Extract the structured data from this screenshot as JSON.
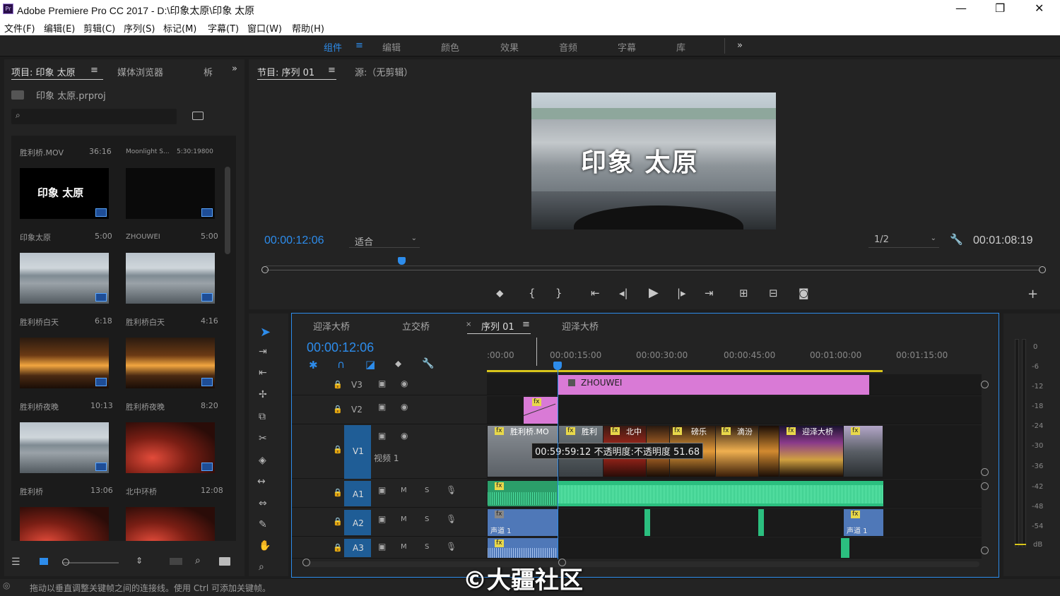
{
  "window": {
    "title": "Adobe Premiere Pro CC 2017 - D:\\印象太原\\印象 太原",
    "app_icon": "Pr",
    "controls": [
      "—",
      "❐",
      "✕"
    ]
  },
  "menu": [
    "文件(F)",
    "编辑(E)",
    "剪辑(C)",
    "序列(S)",
    "标记(M)",
    "字幕(T)",
    "窗口(W)",
    "帮助(H)"
  ],
  "workspaces": {
    "items": [
      "组件",
      "编辑",
      "颜色",
      "效果",
      "音频",
      "字幕",
      "库"
    ],
    "active": "组件",
    "more": "»"
  },
  "project": {
    "tabs": [
      "项目: 印象 太原",
      "媒体浏览器",
      "柝"
    ],
    "file": "印象 太原.prproj",
    "search_placeholder": "",
    "items": [
      {
        "name": "胜利桥.MOV",
        "dur": "36:16"
      },
      {
        "name": "Moonlight S...",
        "dur": "5:30:19800"
      },
      {
        "name": "印象太原",
        "dur": "5:00"
      },
      {
        "name": "ZHOUWEI",
        "dur": "5:00"
      },
      {
        "name": "胜利桥白天",
        "dur": "6:18"
      },
      {
        "name": "胜利桥白天",
        "dur": "4:16"
      },
      {
        "name": "胜利桥夜晚",
        "dur": "10:13"
      },
      {
        "name": "胜利桥夜晚",
        "dur": "8:20"
      },
      {
        "name": "胜利桥",
        "dur": "13:06"
      },
      {
        "name": "北中环桥",
        "dur": "12:08"
      }
    ],
    "title_card": "印象 太原"
  },
  "program": {
    "tabs": [
      "节目: 序列 01",
      "源:（无剪辑）"
    ],
    "overlay_title": "印象 太原",
    "timecode": "00:00:12:06",
    "fit": "适合",
    "resolution": "1/2",
    "duration": "00:01:08:19",
    "playhead_fraction": 0.175
  },
  "timeline": {
    "tabs": [
      "迎泽大桥",
      "立交桥",
      "序列 01",
      "迎泽大桥"
    ],
    "active_tab": "序列 01",
    "timecode": "00:00:12:06",
    "ruler": [
      ":00:00",
      "00:00:15:00",
      "00:00:30:00",
      "00:00:45:00",
      "00:01:00:00",
      "00:01:15:00"
    ],
    "tracks_video": [
      {
        "id": "V3"
      },
      {
        "id": "V2"
      },
      {
        "id": "V1",
        "name": "视频 1"
      }
    ],
    "tracks_audio": [
      {
        "id": "A1"
      },
      {
        "id": "A2"
      },
      {
        "id": "A3"
      }
    ],
    "track_letters": {
      "m": "M",
      "s": "S"
    },
    "clips": {
      "zhouwei": "ZHOUWEI",
      "v1_labels": [
        "胜利桥.MO",
        "胜利",
        "北中",
        "磅乐",
        "滴汾",
        "迎泽大桥"
      ],
      "tooltip": "00:59:59:12  不透明度:不透明度  51.68",
      "audio_label": "声道 1"
    }
  },
  "meter": {
    "scale": [
      "0",
      "-6",
      "-12",
      "-18",
      "-24",
      "-30",
      "-36",
      "-42",
      "-48",
      "-54",
      "dB"
    ]
  },
  "status": "拖动以垂直调整关键帧之间的连接线。使用 Ctrl 可添加关键帧。",
  "watermark": "©大疆社区",
  "colors": {
    "accent": "#2d8ceb",
    "v2_clip": "#d97ad6",
    "audio": "#2bbf7f",
    "audio_blue": "#4f78b8",
    "timecode": "#2d8ceb"
  }
}
